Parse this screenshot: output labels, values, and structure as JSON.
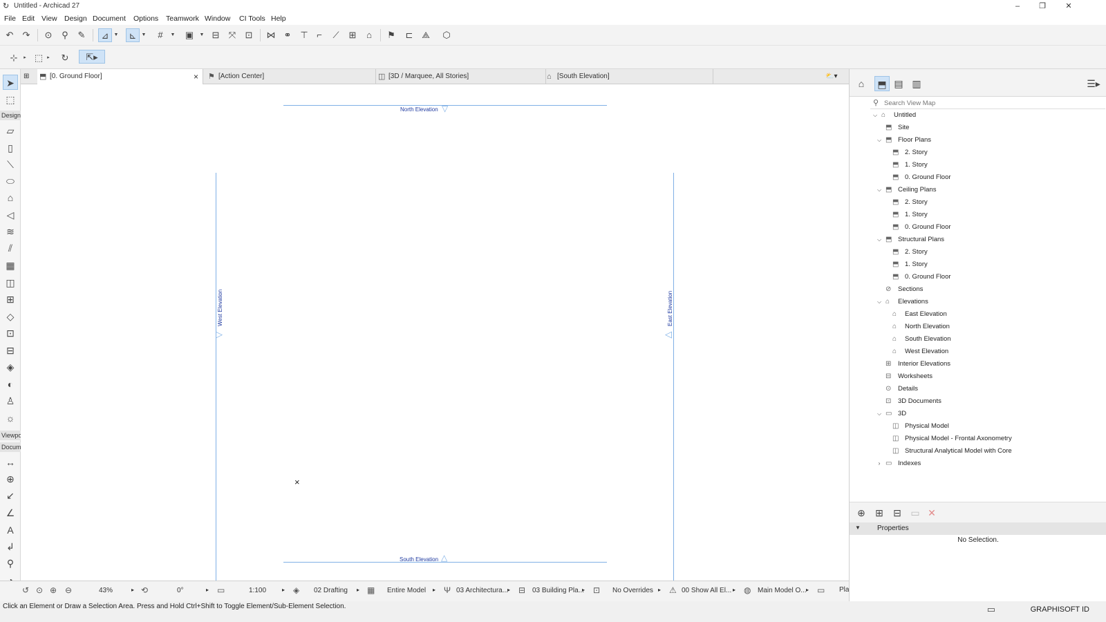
{
  "window": {
    "title": "Untitled - Archicad 27",
    "minimize": "–",
    "maximize": "❐",
    "close": "✕"
  },
  "menu": [
    "File",
    "Edit",
    "View",
    "Design",
    "Document",
    "Options",
    "Teamwork",
    "Window",
    "CI Tools",
    "Help"
  ],
  "toolbox": {
    "design_label": "Design",
    "viewpoint_label": "Viewpoint",
    "document_label": "Document"
  },
  "tabs": [
    {
      "label": "[0. Ground Floor]",
      "icon": "floor-plan-icon"
    },
    {
      "label": "[Action Center]",
      "icon": "action-center-icon"
    },
    {
      "label": "[3D / Marquee, All Stories]",
      "icon": "3d-icon"
    },
    {
      "label": "[South Elevation]",
      "icon": "elevation-icon"
    }
  ],
  "tab_close": "×",
  "canvas": {
    "north_label": "North Elevation",
    "south_label": "South Elevation",
    "west_label": "West Elevation",
    "east_label": "East Elevation",
    "cursor_mark": "×"
  },
  "bottom": {
    "zoom": "43%",
    "angle": "0°",
    "scale": "1:100",
    "layer_combo": "02 Drafting",
    "model_filter": "Entire Model",
    "pen_set": "03 Architectura...",
    "model_view": "03 Building Pla...",
    "graphic_override": "No Overrides",
    "renovation": "00 Show All El...",
    "structural": "Main Model O...",
    "dimension": "Plain Meter"
  },
  "status": {
    "message": "Click an Element or Draw a Selection Area. Press and Hold Ctrl+Shift to Toggle Element/Sub-Element Selection.",
    "graphisoft_id": "GRAPHISOFT ID"
  },
  "navigator": {
    "search_placeholder": "Search View Map",
    "tree": [
      {
        "label": "Untitled",
        "level": 0,
        "expanded": true,
        "icon": "project-icon"
      },
      {
        "label": "Site",
        "level": 1,
        "icon": "story-icon"
      },
      {
        "label": "Floor Plans",
        "level": 1,
        "expanded": true,
        "icon": "folder-plan-icon"
      },
      {
        "label": "2. Story",
        "level": 2,
        "icon": "story-icon"
      },
      {
        "label": "1. Story",
        "level": 2,
        "icon": "story-icon"
      },
      {
        "label": "0. Ground Floor",
        "level": 2,
        "icon": "story-icon"
      },
      {
        "label": "Ceiling Plans",
        "level": 1,
        "expanded": true,
        "icon": "folder-plan-icon"
      },
      {
        "label": "2. Story",
        "level": 2,
        "icon": "story-icon"
      },
      {
        "label": "1. Story",
        "level": 2,
        "icon": "story-icon"
      },
      {
        "label": "0. Ground Floor",
        "level": 2,
        "icon": "story-icon"
      },
      {
        "label": "Structural Plans",
        "level": 1,
        "expanded": true,
        "icon": "folder-plan-icon"
      },
      {
        "label": "2. Story",
        "level": 2,
        "icon": "story-icon"
      },
      {
        "label": "1. Story",
        "level": 2,
        "icon": "story-icon"
      },
      {
        "label": "0. Ground Floor",
        "level": 2,
        "icon": "story-icon"
      },
      {
        "label": "Sections",
        "level": 1,
        "icon": "section-icon"
      },
      {
        "label": "Elevations",
        "level": 1,
        "expanded": true,
        "icon": "folder-elev-icon"
      },
      {
        "label": "East Elevation",
        "level": 2,
        "icon": "elevation-icon"
      },
      {
        "label": "North Elevation",
        "level": 2,
        "icon": "elevation-icon"
      },
      {
        "label": "South Elevation",
        "level": 2,
        "icon": "elevation-icon"
      },
      {
        "label": "West Elevation",
        "level": 2,
        "icon": "elevation-icon"
      },
      {
        "label": "Interior Elevations",
        "level": 1,
        "icon": "interior-elev-icon"
      },
      {
        "label": "Worksheets",
        "level": 1,
        "icon": "worksheet-icon"
      },
      {
        "label": "Details",
        "level": 1,
        "icon": "detail-icon"
      },
      {
        "label": "3D Documents",
        "level": 1,
        "icon": "3d-doc-icon"
      },
      {
        "label": "3D",
        "level": 1,
        "expanded": true,
        "icon": "folder-icon"
      },
      {
        "label": "Physical Model",
        "level": 2,
        "icon": "3d-icon"
      },
      {
        "label": "Physical Model - Frontal Axonometry",
        "level": 2,
        "icon": "3d-icon"
      },
      {
        "label": "Structural Analytical Model with Core",
        "level": 2,
        "icon": "3d-icon"
      },
      {
        "label": "Indexes",
        "level": 1,
        "expanded": false,
        "icon": "folder-icon"
      }
    ],
    "properties_label": "Properties",
    "no_selection": "No Selection."
  }
}
